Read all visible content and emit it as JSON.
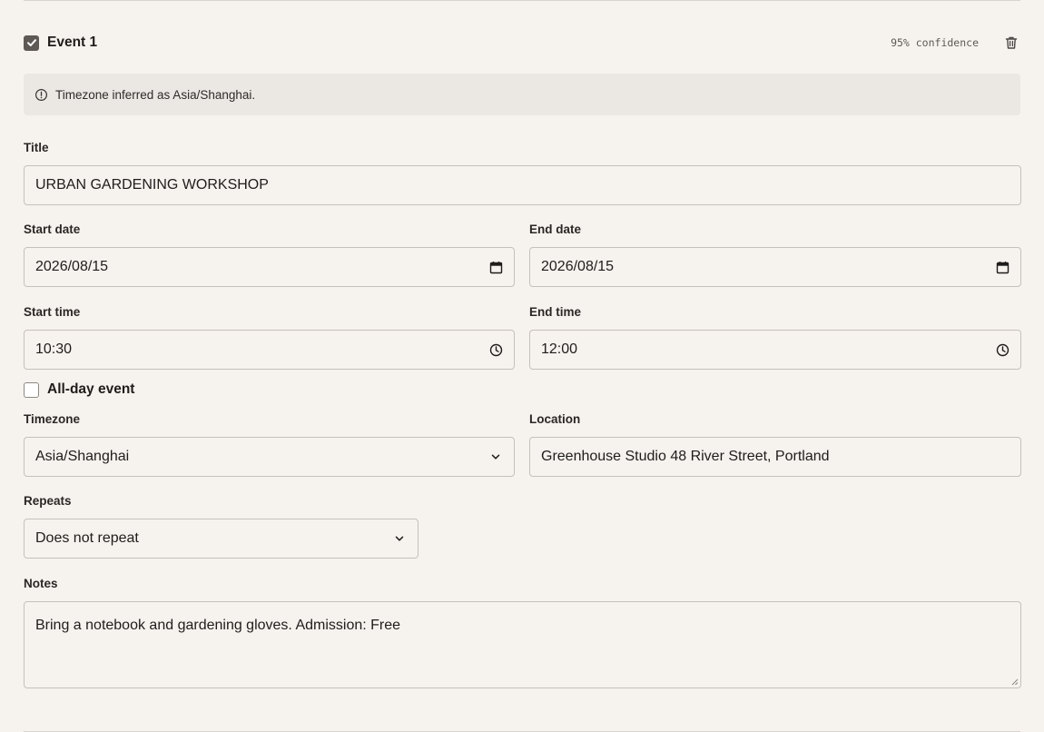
{
  "event": {
    "name": "Event 1",
    "selected": true,
    "confidence": "95% confidence"
  },
  "notice": {
    "text": "Timezone inferred as Asia/Shanghai."
  },
  "form": {
    "title_label": "Title",
    "title_value": "URBAN GARDENING WORKSHOP",
    "start_date_label": "Start date",
    "start_date_value": "2026/08/15",
    "end_date_label": "End date",
    "end_date_value": "2026/08/15",
    "start_time_label": "Start time",
    "start_time_value": "10:30",
    "end_time_label": "End time",
    "end_time_value": "12:00",
    "all_day_label": "All-day event",
    "all_day_checked": false,
    "timezone_label": "Timezone",
    "timezone_value": "Asia/Shanghai",
    "location_label": "Location",
    "location_value": "Greenhouse Studio 48 River Street, Portland",
    "repeats_label": "Repeats",
    "repeats_value": "Does not repeat",
    "notes_label": "Notes",
    "notes_value": "Bring a notebook and gardening gloves. Admission: Free"
  },
  "icons": {
    "checkbox": "checkmark-icon",
    "delete": "trash-icon",
    "info": "info-circle-icon",
    "calendar": "calendar-icon",
    "clock": "clock-icon",
    "dropdown": "chevron-down-icon"
  },
  "colors": {
    "background": "#f6f2ee",
    "notice_background": "#ebe7e3",
    "border": "#c5c0bb",
    "checkbox_fill": "#5e5955"
  }
}
